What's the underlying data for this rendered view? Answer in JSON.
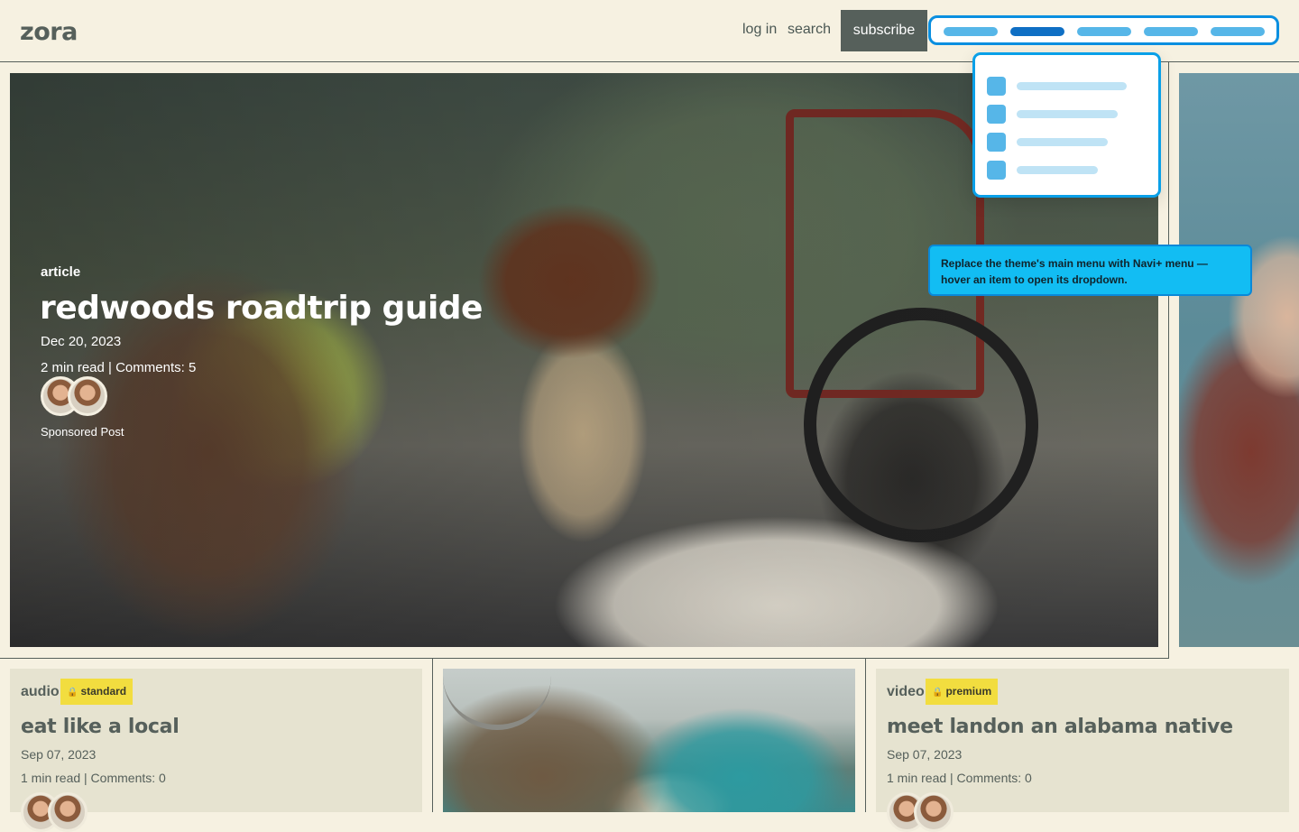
{
  "header": {
    "logo": "zora",
    "login": "log in",
    "search": "search",
    "subscribe": "subscribe"
  },
  "tooltip": {
    "text": "Replace the theme's main menu with Navi+ menu — hover an item to open its dropdown."
  },
  "hero": {
    "category": "article",
    "title": "redwoods roadtrip guide",
    "date": "Dec 20, 2023",
    "meta": "2 min read | Comments: 5",
    "sponsored": "Sponsored Post"
  },
  "cards": [
    {
      "category": "audio",
      "badge": "standard",
      "title": "eat like a local",
      "date": "Sep 07, 2023",
      "meta": "1 min read  |  Comments: 0"
    },
    {
      "category": "video",
      "badge": "premium",
      "title": "meet landon an alabama native",
      "date": "Sep 07, 2023",
      "meta": "1 min read  |  Comments: 0"
    }
  ],
  "colors": {
    "page_bg": "#f6f1e1",
    "text": "#4a5753",
    "subscribe_bg": "#56605b",
    "navi_border": "#0a8fe0",
    "navi_active": "#0f6fc4",
    "tooltip_bg": "#12bdf3",
    "badge_bg": "#f2dd3f",
    "card_bg": "#e6e3d0"
  },
  "icons": {
    "badge_lock": "lock-icon"
  }
}
